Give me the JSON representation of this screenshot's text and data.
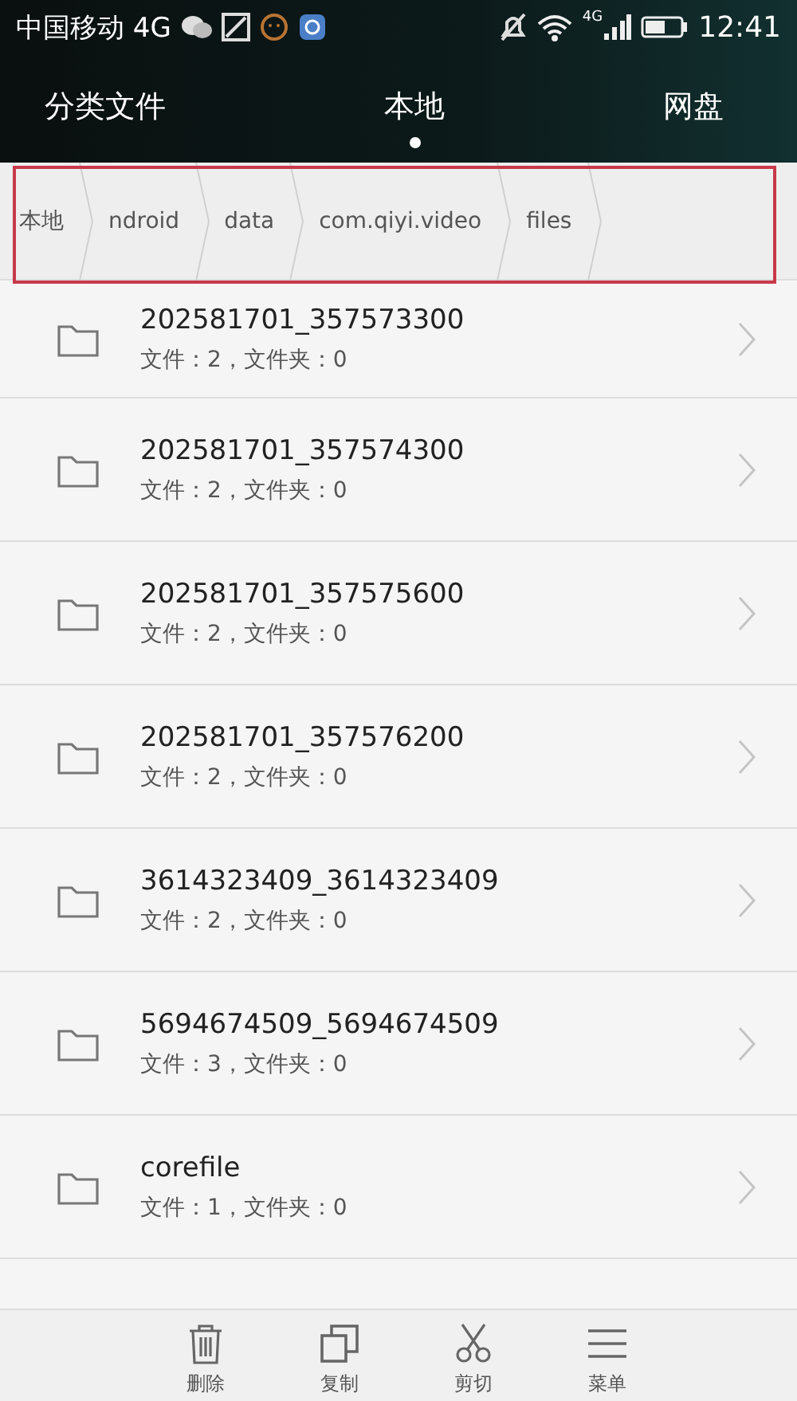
{
  "status_bar": {
    "carrier": "中国移动 4G",
    "network_label": "4G",
    "time": "12:41"
  },
  "tabs": [
    {
      "label": "分类文件",
      "selected": false
    },
    {
      "label": "本地",
      "selected": true
    },
    {
      "label": "网盘",
      "selected": false
    }
  ],
  "breadcrumb": [
    "本地",
    "ndroid",
    "data",
    "com.qiyi.video",
    "files"
  ],
  "files": [
    {
      "name": "202581701_357573300",
      "info": "文件：2，文件夹：0"
    },
    {
      "name": "202581701_357574300",
      "info": "文件：2，文件夹：0"
    },
    {
      "name": "202581701_357575600",
      "info": "文件：2，文件夹：0"
    },
    {
      "name": "202581701_357576200",
      "info": "文件：2，文件夹：0"
    },
    {
      "name": "3614323409_3614323409",
      "info": "文件：2，文件夹：0"
    },
    {
      "name": "5694674509_5694674509",
      "info": "文件：3，文件夹：0"
    },
    {
      "name": "corefile",
      "info": "文件：1，文件夹：0"
    }
  ],
  "toolbar": [
    {
      "kind": "delete",
      "label": "删除"
    },
    {
      "kind": "copy",
      "label": "复制"
    },
    {
      "kind": "cut",
      "label": "剪切"
    },
    {
      "kind": "menu",
      "label": "菜单"
    }
  ]
}
